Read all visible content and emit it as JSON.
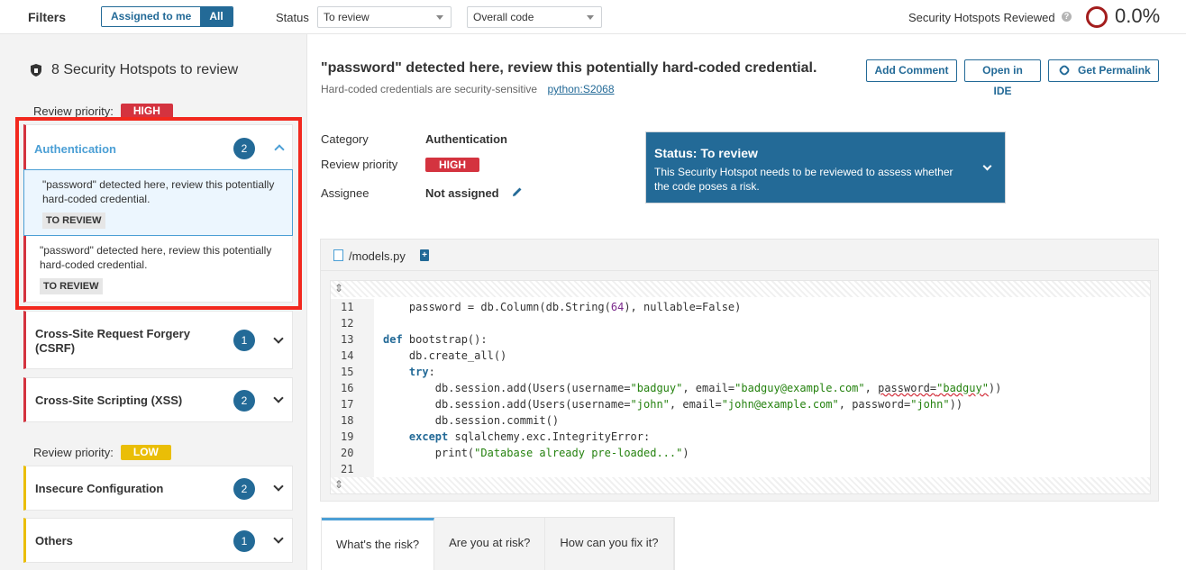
{
  "filters": {
    "title": "Filters",
    "assigned_to_me": "Assigned to me",
    "all": "All",
    "status_label": "Status",
    "status_value": "To review",
    "code_value": "Overall code",
    "reviewed_label": "Security Hotspots Reviewed",
    "help_glyph": "?",
    "reviewed_pct": "0.0%"
  },
  "sidebar": {
    "heading": "8 Security Hotspots to review",
    "priority_label": "Review priority:",
    "high": "HIGH",
    "low": "LOW",
    "categories": [
      {
        "title": "Authentication",
        "count": "2",
        "priority": "high",
        "expanded": true
      },
      {
        "title": "Cross-Site Request Forgery (CSRF)",
        "count": "1",
        "priority": "high"
      },
      {
        "title": "Cross-Site Scripting (XSS)",
        "count": "2",
        "priority": "high"
      },
      {
        "title": "Insecure Configuration",
        "count": "2",
        "priority": "low"
      },
      {
        "title": "Others",
        "count": "1",
        "priority": "low"
      }
    ],
    "hotspots": [
      {
        "message": "\"password\" detected here, review this potentially hard-coded credential.",
        "status": "TO REVIEW",
        "selected": true
      },
      {
        "message": "\"password\" detected here, review this potentially hard-coded credential.",
        "status": "TO REVIEW",
        "selected": false
      }
    ]
  },
  "main": {
    "title": "\"password\" detected here, review this potentially hard-coded credential.",
    "subtitle": "Hard-coded credentials are security-sensitive",
    "rule": "python:S2068",
    "buttons": {
      "add_comment": "Add Comment",
      "open_ide": "Open in IDE",
      "permalink": "Get Permalink"
    },
    "meta": {
      "category_label": "Category",
      "category_value": "Authentication",
      "priority_label": "Review priority",
      "priority_value": "HIGH",
      "assignee_label": "Assignee",
      "assignee_value": "Not assigned"
    },
    "status_box": {
      "title": "Status: To review",
      "description": "This Security Hotspot needs to be reviewed to assess whether the code poses a risk."
    },
    "file": {
      "name": "/models.py"
    },
    "code_lines": [
      {
        "n": "11",
        "text": "    password = db.Column(db.String(64), nullable=False)"
      },
      {
        "n": "12",
        "text": ""
      },
      {
        "n": "13",
        "text": "def bootstrap():"
      },
      {
        "n": "14",
        "text": "    db.create_all()"
      },
      {
        "n": "15",
        "text": "    try:"
      },
      {
        "n": "16",
        "text": "        db.session.add(Users(username=\"badguy\", email=\"badguy@example.com\", password=\"badguy\"))"
      },
      {
        "n": "17",
        "text": "        db.session.add(Users(username=\"john\", email=\"john@example.com\", password=\"john\"))"
      },
      {
        "n": "18",
        "text": "        db.session.commit()"
      },
      {
        "n": "19",
        "text": "    except sqlalchemy.exc.IntegrityError:"
      },
      {
        "n": "20",
        "text": "        print(\"Database already pre-loaded...\")"
      },
      {
        "n": "21",
        "text": ""
      }
    ],
    "tabs": [
      "What's the risk?",
      "Are you at risk?",
      "How can you fix it?"
    ]
  },
  "colors": {
    "accent": "#236a97",
    "high": "#d4333f",
    "low": "#eabe06",
    "highlight_box": "#f2281e"
  }
}
